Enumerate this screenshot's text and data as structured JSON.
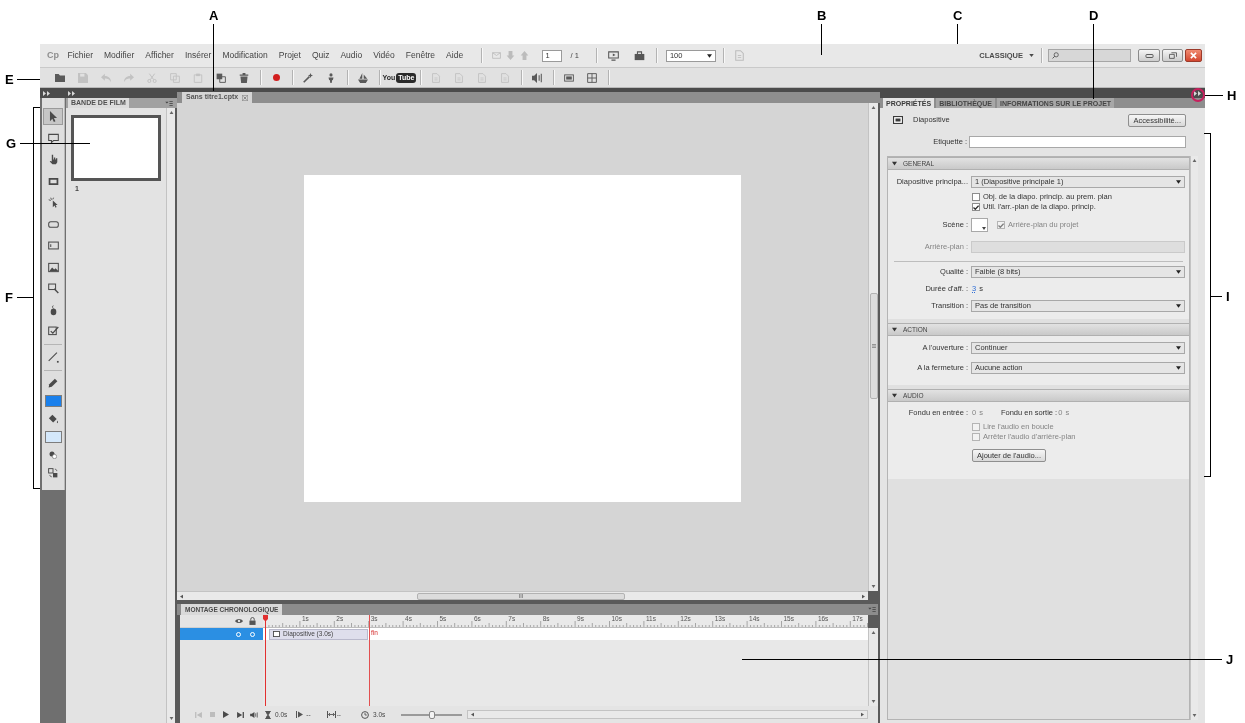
{
  "callouts": [
    {
      "label": "A"
    },
    {
      "label": "B"
    },
    {
      "label": "C"
    },
    {
      "label": "D"
    },
    {
      "label": "E"
    },
    {
      "label": "H"
    },
    {
      "label": "G"
    },
    {
      "label": "F"
    },
    {
      "label": "I"
    },
    {
      "label": "J"
    }
  ],
  "menu_bar": {
    "logo": "Cp",
    "items": [
      "Fichier",
      "Modifier",
      "Afficher",
      "Insérer",
      "Modification",
      "Projet",
      "Quiz",
      "Audio",
      "Vidéo",
      "Fenêtre",
      "Aide"
    ],
    "nav_buttons": [
      {
        "disabled": true
      },
      {
        "disabled": true
      },
      {
        "disabled": true
      }
    ],
    "slide_field": {
      "value": "1"
    },
    "slide_total": "/ 1",
    "view_buttons": [
      {
        "disabled": false
      },
      {
        "disabled": false
      }
    ],
    "zoom_field": {
      "value": "100"
    },
    "extra_buttons": [
      {
        "disabled": true
      }
    ],
    "workspace": "CLASSIQUE"
  },
  "toolbar": {
    "groups": [
      [
        {
          "kind": "icon",
          "disabled": false
        },
        {
          "kind": "icon",
          "disabled": true
        },
        {
          "kind": "icon",
          "disabled": true
        },
        {
          "kind": "icon",
          "disabled": true
        },
        {
          "kind": "icon",
          "disabled": true
        },
        {
          "kind": "icon",
          "disabled": true
        },
        {
          "kind": "icon",
          "disabled": true
        },
        {
          "kind": "icon",
          "disabled": false
        },
        {
          "kind": "icon",
          "disabled": false
        }
      ],
      [
        {
          "kind": "icon",
          "disabled": false
        }
      ],
      [
        {
          "kind": "icon",
          "disabled": false
        },
        {
          "kind": "icon",
          "disabled": false
        }
      ],
      [
        {
          "kind": "icon",
          "disabled": false
        }
      ],
      [
        {
          "kind": "logo",
          "text": "You",
          "badge": "Tube",
          "disabled": false
        }
      ],
      [
        {
          "kind": "icon",
          "disabled": true
        },
        {
          "kind": "icon",
          "disabled": true
        },
        {
          "kind": "icon",
          "disabled": true
        },
        {
          "kind": "icon",
          "disabled": true
        }
      ],
      [
        {
          "kind": "icon",
          "disabled": false
        }
      ],
      [
        {
          "kind": "icon",
          "disabled": false
        },
        {
          "kind": "icon",
          "disabled": false
        }
      ]
    ]
  },
  "tools_panel": {
    "tools": [
      {
        "selected": true
      },
      {
        "selected": false
      },
      {
        "selected": false
      },
      {
        "selected": false
      },
      {
        "selected": false
      },
      {
        "selected": false
      },
      {
        "selected": false
      },
      {
        "selected": false
      },
      {
        "selected": false
      },
      {
        "selected": false
      },
      {
        "selected": false
      },
      {
        "selected": false
      }
    ],
    "colors": [
      {
        "color": "#1a80ec"
      },
      {
        "color": "#d4e8fb"
      }
    ]
  },
  "filmstrip": {
    "title": "BANDE DE FILM",
    "slides": [
      {
        "number": "1",
        "selected": true
      }
    ]
  },
  "document_tab": {
    "title": "Sans titre1.cptx"
  },
  "timeline": {
    "title": "MONTAGE CHRONOLOGIQUE",
    "ruler_labels": [
      "1s",
      "2s",
      "3s",
      "4s",
      "5s",
      "6s",
      "7s",
      "8s",
      "9s",
      "10s",
      "11s",
      "12s",
      "13s",
      "14s",
      "15s",
      "16s",
      "17s"
    ],
    "layers": [
      {
        "selected": true,
        "clip": "Diapositive (3.0s)"
      }
    ],
    "end_label": "fin",
    "playback_buttons": [
      {
        "disabled": true
      },
      {
        "disabled": true
      },
      {
        "disabled": false
      },
      {
        "disabled": false
      },
      {
        "disabled": false
      }
    ],
    "current_time": "0.0s",
    "start_time": "--",
    "clip_duration": "--",
    "total_time": "3.0s",
    "zoom_slider": {
      "level": 0.5
    }
  },
  "properties": {
    "tabs": [
      {
        "label": "PROPRIÉTÉS",
        "selected": true
      },
      {
        "label": "BIBLIOTHÈQUE",
        "selected": false
      },
      {
        "label": "INFORMATIONS SUR LE PROJET",
        "selected": false
      }
    ],
    "title": "Diapositive",
    "accessibility_button": "Accessibilité...",
    "label_field": {
      "label": "Etiquette :"
    },
    "sections": [
      {
        "title": "GENERAL",
        "expanded": true,
        "rows": [
          {
            "kind": "dropdown",
            "label": "Diapositive principa...",
            "value": "1 (Diapositive principale 1)"
          },
          {
            "kind": "checkbox",
            "label": "Obj. de la diapo. princip. au prem. plan",
            "checked": false,
            "disabled": false
          },
          {
            "kind": "checkbox",
            "label": "Util. l'arr.-plan de la diapo. princip.",
            "checked": true,
            "disabled": false
          },
          {
            "kind": "scene",
            "label": "Scène :",
            "option": {
              "label": "Arrière-plan du projet",
              "checked": true,
              "disabled": true
            }
          },
          {
            "kind": "field",
            "label": "Arrière-plan :",
            "disabled": true
          },
          {
            "kind": "dropdown",
            "label": "Qualité :",
            "value": "Faible (8 bits)",
            "rule_above": true
          },
          {
            "kind": "duration",
            "label": "Durée d'aff. :",
            "value": "3",
            "unit": "s"
          },
          {
            "kind": "dropdown",
            "label": "Transition :",
            "value": "Pas de transition"
          }
        ]
      },
      {
        "title": "ACTION",
        "expanded": true,
        "rows": [
          {
            "kind": "dropdown",
            "label": "A l'ouverture :",
            "value": "Continuer"
          },
          {
            "kind": "dropdown",
            "label": "A la fermeture :",
            "value": "Aucune action"
          }
        ]
      },
      {
        "title": "AUDIO",
        "expanded": true,
        "rows": [
          {
            "kind": "fades",
            "fields": [
              {
                "label": "Fondu en entrée :",
                "value": "0",
                "unit": "s",
                "disabled": true
              },
              {
                "label": "Fondu en sortie :",
                "value": "0",
                "unit": "s",
                "disabled": true
              }
            ]
          },
          {
            "kind": "checkbox",
            "label": "Lire l'audio en boucle",
            "checked": false,
            "disabled": true
          },
          {
            "kind": "checkbox",
            "label": "Arrêter l'audio d'arrière-plan",
            "checked": false,
            "disabled": true
          },
          {
            "kind": "button",
            "label": "Ajouter de l'audio..."
          }
        ]
      }
    ]
  }
}
